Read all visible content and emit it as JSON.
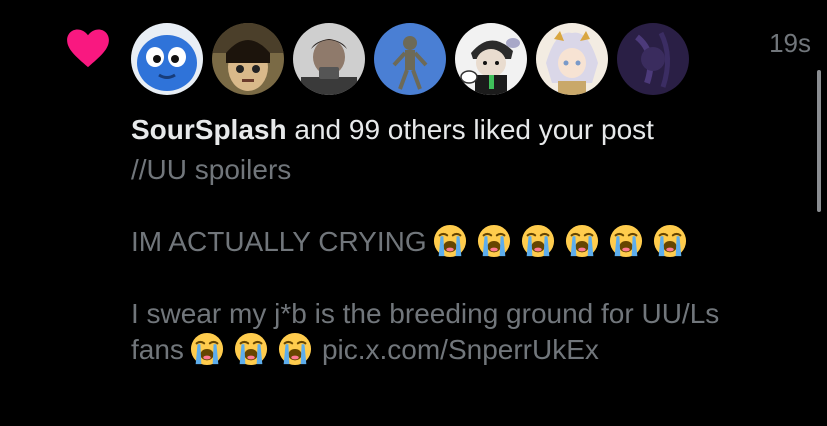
{
  "colors": {
    "background": "#000000",
    "heart": "#f91880",
    "primary_text": "#e7e9ea",
    "secondary_text": "#71767b"
  },
  "notification": {
    "icon": "heart-icon",
    "timestamp": "19s",
    "headline": {
      "username": "SourSplash",
      "rest": " and 99 others liked your post"
    },
    "avatars": [
      {
        "name": "avatar-blue-cartoon"
      },
      {
        "name": "avatar-doll-photo"
      },
      {
        "name": "avatar-blurred-person"
      },
      {
        "name": "avatar-blue-figure"
      },
      {
        "name": "avatar-drawn-character"
      },
      {
        "name": "avatar-anime-character"
      },
      {
        "name": "avatar-dark-purple"
      }
    ],
    "post": {
      "line1": "//UU spoilers",
      "line2": "IM ACTUALLY CRYING",
      "line2_emoji_count": 6,
      "line3": "I swear my j*b is the breeding ground for UU/Ls",
      "line4_start": "fans",
      "line4_emoji_count": 3,
      "link": "pic.x.com/SnperrUkEx",
      "emoji_icon": "loudly-crying-face-icon"
    }
  }
}
